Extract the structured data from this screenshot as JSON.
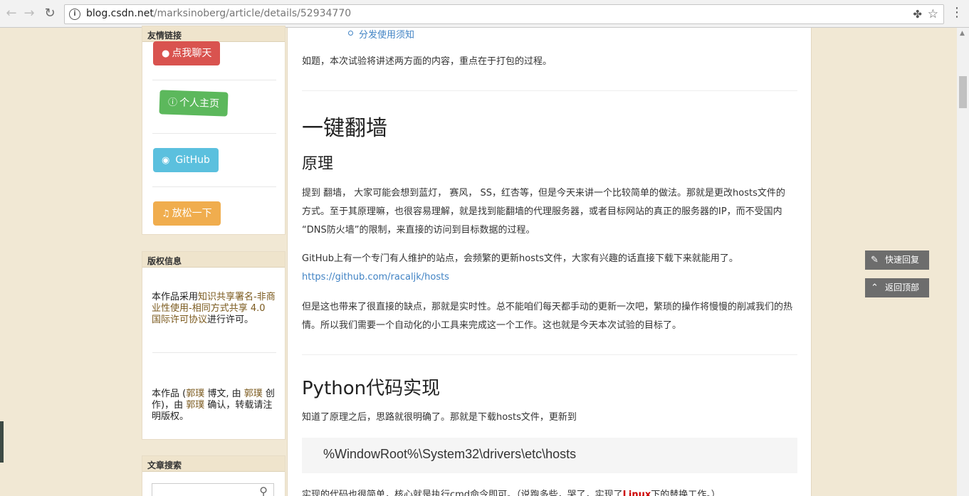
{
  "browser": {
    "url_host": "blog.csdn.net",
    "url_path": "/marksinoberg/article/details/52934770",
    "back_icon": "back-arrow-icon",
    "forward_icon": "forward-arrow-icon",
    "reload_icon": "reload-icon"
  },
  "sidebar": {
    "links_title": "友情链接",
    "links": [
      {
        "label": "点我聊天",
        "icon": "user-icon",
        "color": "#d9534f"
      },
      {
        "label": "个人主页",
        "icon": "info-circle-icon",
        "color": "#5cb85c"
      },
      {
        "label": "GitHub",
        "icon": "globe-icon",
        "color": "#5bc0de"
      },
      {
        "label": "放松一下",
        "icon": "headphones-icon",
        "color": "#f0ad4e"
      }
    ],
    "copyright_title": "版权信息",
    "license_pre": "本作品采用",
    "license_link": "知识共享署名-非商业性使用-相同方式共享 4.0 国际许可协议",
    "license_post": "进行许可。",
    "attr_1": "本作品 (",
    "attr_author": "郭璞",
    "attr_2": " 博文, 由 ",
    "attr_author2": "郭璞",
    "attr_3": " 创作)，由 ",
    "attr_author3": "郭璞",
    "attr_4": " 确认，转载请注明版权。",
    "search_title": "文章搜索"
  },
  "article": {
    "toc_item": "分发使用须知",
    "intro": "如题，本次试验将讲述两方面的内容，重点在于打包的过程。",
    "h1": "一键翻墙",
    "h2_principle": "原理",
    "para1": "提到 翻墙， 大家可能会想到蓝灯， 赛风， SS，红杏等，但是今天来讲一个比较简单的做法。那就是更改hosts文件的方式。至于其原理嘛，也很容易理解，就是找到能翻墙的代理服务器，或者目标网站的真正的服务器的IP，而不受国内 “DNS防火墙”的限制，来直接的访问到目标数据的过程。",
    "para2_text": "GitHub上有一个专门有人维护的站点，会频繁的更新hosts文件，大家有兴趣的话直接下载下来就能用了。",
    "para2_link": "https://github.com/racaljk/hosts",
    "para3": "但是这也带来了很直接的缺点，那就是实时性。总不能咱们每天都手动的更新一次吧，繁琐的操作将慢慢的削减我们的热情。所以我们需要一个自动化的小工具来完成这一个工作。这也就是今天本次试验的目标了。",
    "h2_python": "Python代码实现",
    "para4": "知道了原理之后，思路就很明确了。那就是下载hosts文件，更新到",
    "code": "%WindowRoot%\\System32\\drivers\\etc\\hosts",
    "para5_pre": "实现的代码也很简单，核心就是执行cmd命令即可。（说跑多些，哭了，实现了",
    "para5_linux": "Linux",
    "para5_post": "下的替换工作。）"
  },
  "floating": {
    "reply": "快速回复",
    "top": "返回顶部"
  }
}
